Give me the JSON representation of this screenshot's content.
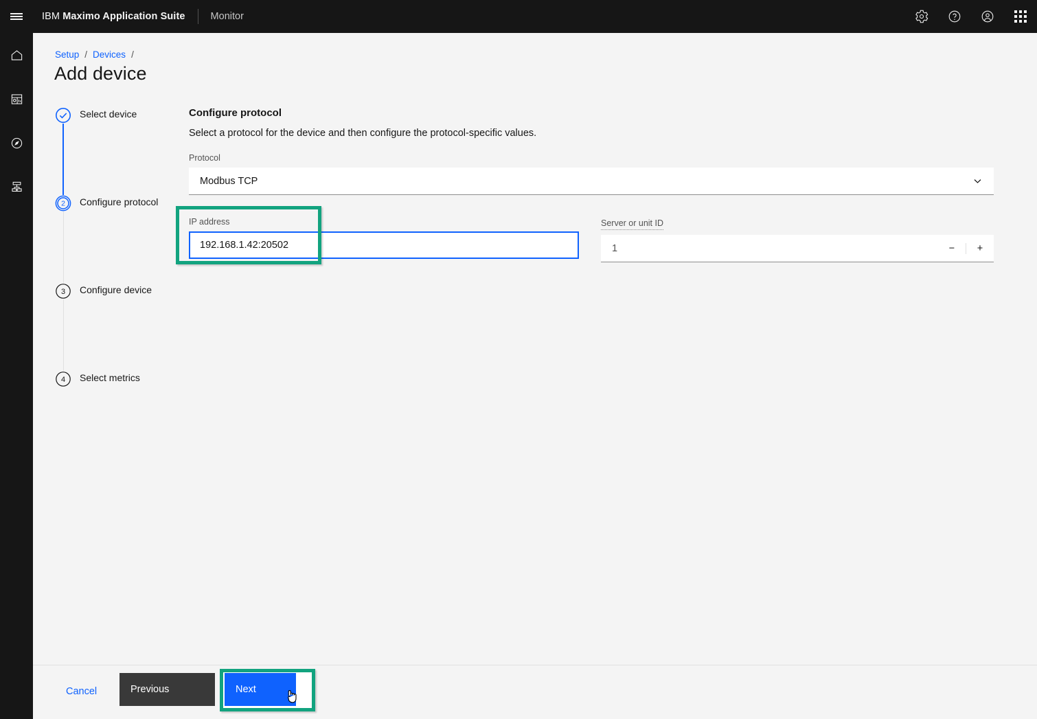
{
  "header": {
    "menu_icon": "hamburger-menu-icon",
    "brand_prefix": "IBM",
    "brand_name": "Maximo Application Suite",
    "app_name": "Monitor",
    "actions": [
      {
        "name": "settings",
        "icon": "gear-icon"
      },
      {
        "name": "help",
        "icon": "help-circle-icon"
      },
      {
        "name": "account",
        "icon": "user-avatar-icon"
      },
      {
        "name": "app-switcher",
        "icon": "grid-dots-icon"
      }
    ]
  },
  "rail": {
    "items": [
      {
        "name": "home",
        "icon": "home-icon"
      },
      {
        "name": "dashboards",
        "icon": "dashboard-icon"
      },
      {
        "name": "explore",
        "icon": "compass-icon"
      },
      {
        "name": "hierarchy",
        "icon": "hierarchy-icon"
      }
    ]
  },
  "breadcrumb": {
    "items": [
      "Setup",
      "Devices"
    ],
    "separator": "/"
  },
  "page": {
    "title": "Add device"
  },
  "stepper": {
    "steps": [
      {
        "label": "Select device",
        "state": "complete",
        "marker": "check"
      },
      {
        "label": "Configure protocol",
        "state": "current",
        "marker": "2"
      },
      {
        "label": "Configure device",
        "state": "incomplete",
        "marker": "3"
      },
      {
        "label": "Select metrics",
        "state": "incomplete",
        "marker": "4"
      }
    ]
  },
  "form": {
    "heading": "Configure protocol",
    "description": "Select a protocol for the device and then configure the protocol-specific values.",
    "protocol": {
      "label": "Protocol",
      "value": "Modbus TCP",
      "chevron": "chevron-down-icon"
    },
    "ip_address": {
      "label": "IP address",
      "value": "192.168.1.42:20502"
    },
    "server_unit_id": {
      "label": "Server or unit ID",
      "value": "1",
      "decrement": "−",
      "increment": "+"
    }
  },
  "footer": {
    "cancel_label": "Cancel",
    "previous_label": "Previous",
    "next_label": "Next"
  },
  "colors": {
    "header_bg": "#161616",
    "page_bg": "#f4f4f4",
    "accent_blue": "#0f62fe",
    "highlight_teal": "#12a37f",
    "secondary_button": "#393939",
    "field_white": "#ffffff",
    "border_gray": "#8d8d8d"
  }
}
